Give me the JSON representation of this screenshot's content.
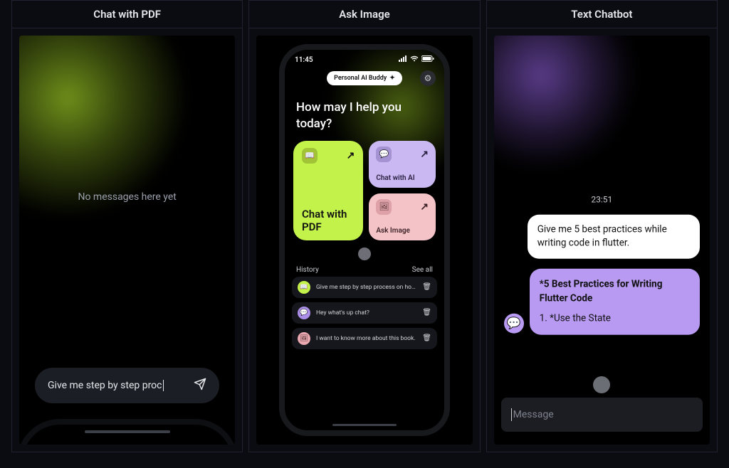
{
  "columns": {
    "pdf": {
      "title": "Chat with PDF"
    },
    "ask": {
      "title": "Ask Image"
    },
    "chat": {
      "title": "Text Chatbot"
    }
  },
  "pdf": {
    "empty_text": "No messages here yet",
    "input_value": "Give me step by step proc"
  },
  "ask": {
    "status_time": "11:45",
    "pill_label": "Personal AI Buddy",
    "pill_sparkle": "✦",
    "hero": "How may I help you today?",
    "tile_big": {
      "label": "Chat with PDF",
      "icon": "book"
    },
    "tile_purple": {
      "label": "Chat with AI",
      "icon": "chat"
    },
    "tile_pink": {
      "label": "Ask Image",
      "icon": "image"
    },
    "history_label": "History",
    "see_all": "See all",
    "history": [
      {
        "badge": "green",
        "icon": "book",
        "text": "Give me step by step process on how t…"
      },
      {
        "badge": "purple",
        "icon": "chat",
        "text": "Hey what's up chat?"
      },
      {
        "badge": "pink",
        "icon": "image",
        "text": "I want to know more about this book."
      }
    ]
  },
  "chat": {
    "time": "23:51",
    "user_msg": "Give me 5 best practices while writing code in flutter.",
    "bot_title": "*5 Best Practices for Writing Flutter Code",
    "bot_line": "1. *Use the State",
    "input_placeholder": "Message"
  },
  "glyphs": {
    "arrow_ne": "↗",
    "gear": "⚙",
    "trash": "🗑",
    "book": "📖",
    "chat": "💬",
    "image": "🖼"
  }
}
